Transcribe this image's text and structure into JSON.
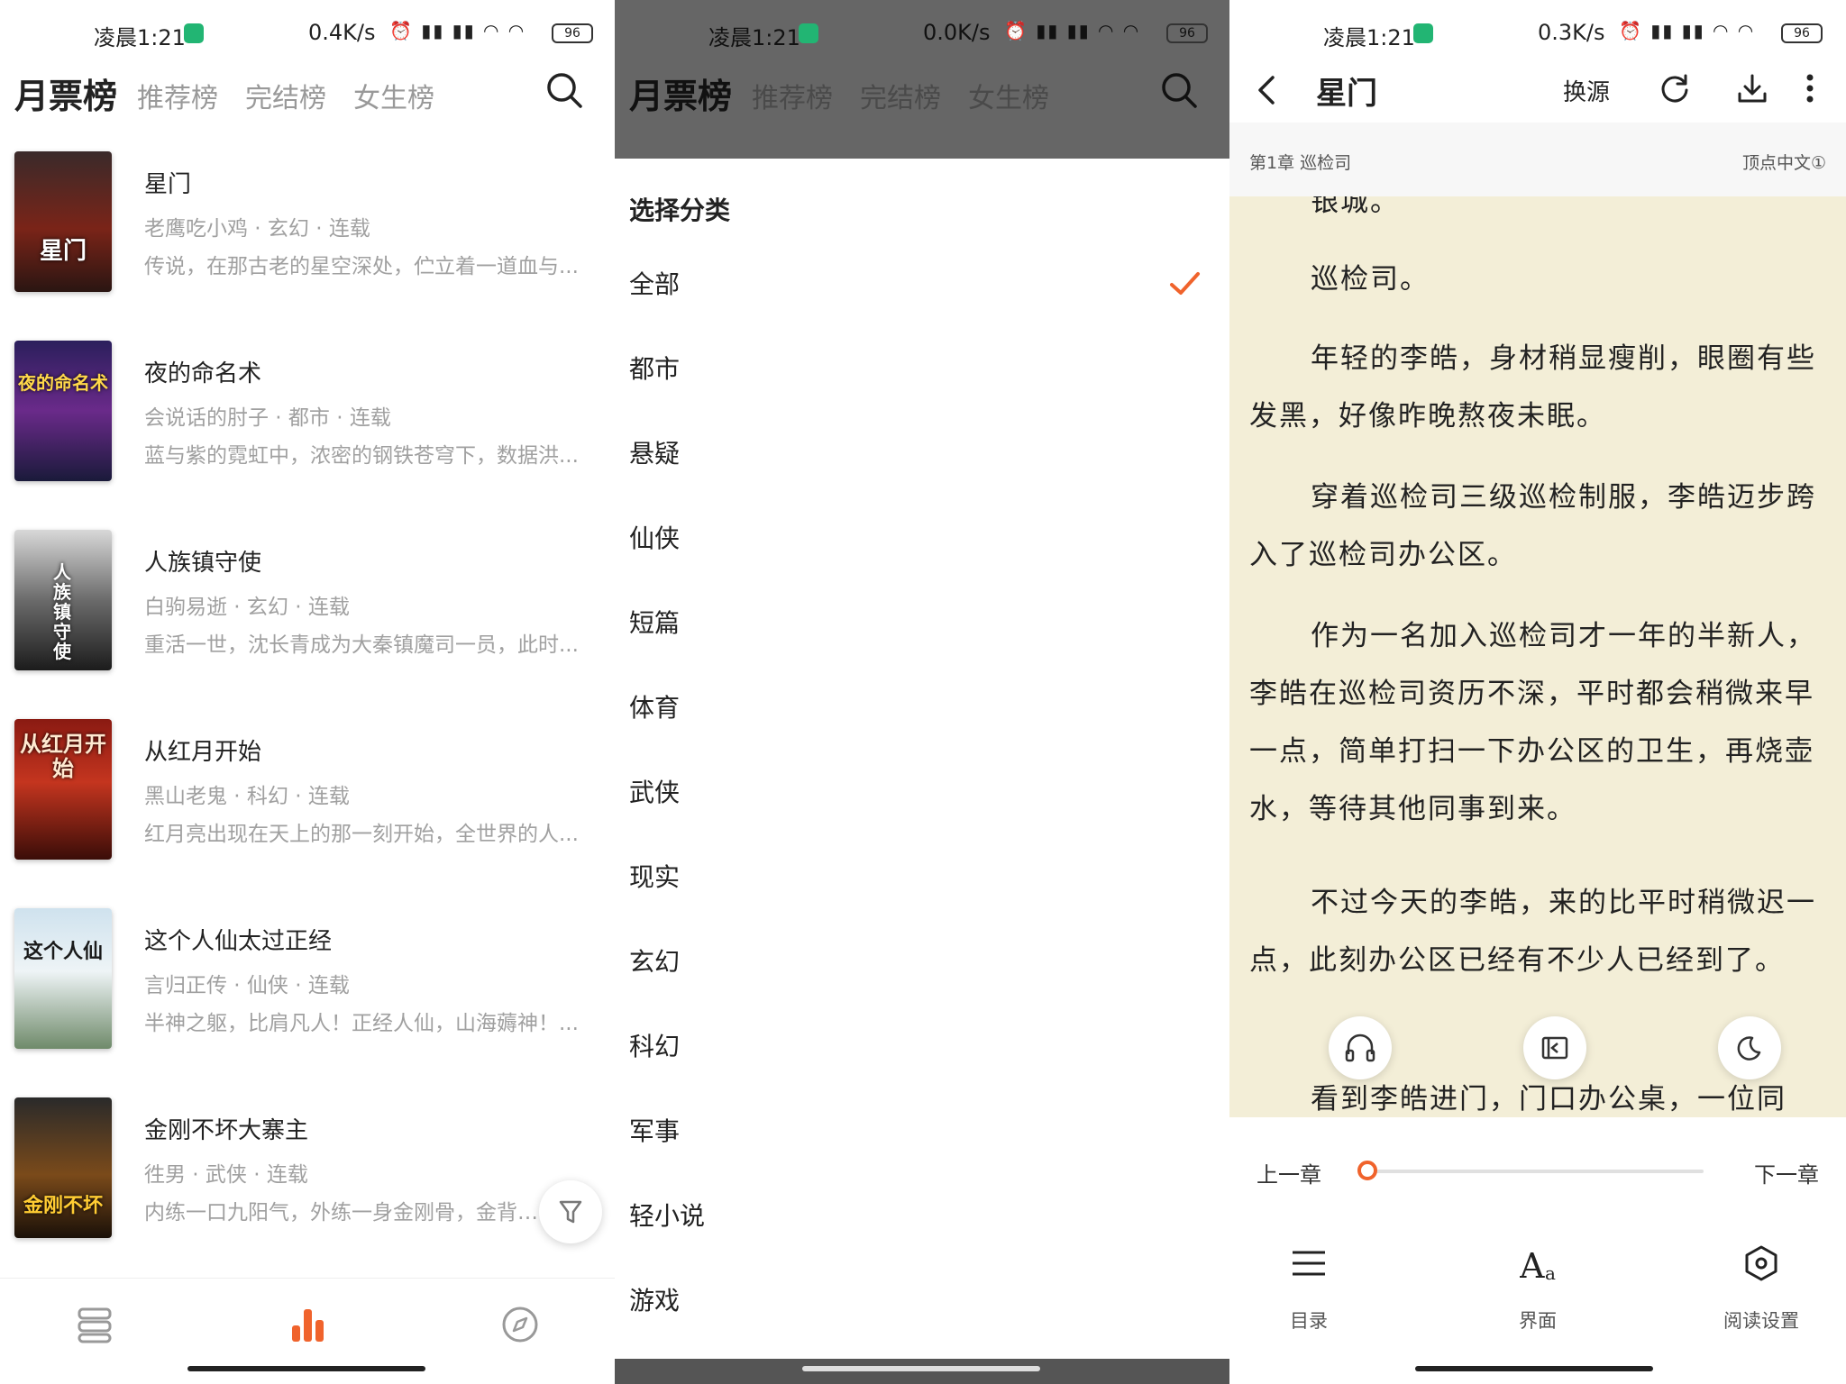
{
  "status_bars": [
    {
      "time": "凌晨1:21",
      "net": "0.4K/s",
      "battery": "96"
    },
    {
      "time": "凌晨1:21",
      "net": "0.0K/s",
      "battery": "96"
    },
    {
      "time": "凌晨1:21",
      "net": "0.3K/s",
      "battery": "96"
    }
  ],
  "ranking": {
    "tabs": [
      "月票榜",
      "推荐榜",
      "完结榜",
      "女生榜"
    ],
    "books": [
      {
        "title": "星门",
        "cover_text": "星门",
        "meta": "老鹰吃小鸡 · 玄幻 · 连载",
        "desc": "传说，在那古老的星空深处，伫立着一道血与..."
      },
      {
        "title": "夜的命名术",
        "cover_text": "夜的命名术",
        "meta": "会说话的肘子 · 都市 · 连载",
        "desc": "蓝与紫的霓虹中，浓密的钢铁苍穹下，数据洪..."
      },
      {
        "title": "人族镇守使",
        "cover_text": "人族镇守使",
        "meta": "白驹易逝 · 玄幻 · 连载",
        "desc": "重活一世，沈长青成为大秦镇魔司一员，此时..."
      },
      {
        "title": "从红月开始",
        "cover_text": "从红月开始",
        "meta": "黑山老鬼 · 科幻 · 连载",
        "desc": "红月亮出现在天上的那一刻开始，全世界的人..."
      },
      {
        "title": "这个人仙太过正经",
        "cover_text": "这个人仙",
        "meta": "言归正传 · 仙侠 · 连载",
        "desc": "半神之躯，比肩凡人！正经人仙，山海薅神！..."
      },
      {
        "title": "金刚不坏大寨主",
        "cover_text": "金刚不坏",
        "meta": "徃男 · 武侠 · 连载",
        "desc": "内练一口九阳气，外练一身金刚骨，金背大..."
      }
    ]
  },
  "category_sheet": {
    "title": "选择分类",
    "items": [
      "全部",
      "都市",
      "悬疑",
      "仙侠",
      "短篇",
      "体育",
      "武侠",
      "现实",
      "玄幻",
      "科幻",
      "军事",
      "轻小说",
      "游戏"
    ],
    "selected": "全部",
    "accent": "#f0632c"
  },
  "reader": {
    "book_title": "星门",
    "change_source": "换源",
    "chapter": "第1章 巡检司",
    "source": "顶点中文①",
    "paragraphs": [
      "银城。",
      "巡检司。",
      "年轻的李皓，身材稍显瘦削，眼圈有些发黑，好像昨晚熬夜未眠。",
      "穿着巡检司三级巡检制服，李皓迈步跨入了巡检司办公区。",
      "作为一名加入巡检司才一年的半新人，李皓在巡检司资历不深，平时都会稍微来早一点，简单打扫一下办公区的卫生，再烧壶水，等待其他同事到来。",
      "不过今天的李皓，来的比平时稍微迟一点，此刻办公区已经有不少人已经到了。",
      "看到李皓进门，门口办公桌，一位同"
    ],
    "prev_chapter": "上一章",
    "next_chapter": "下一章",
    "progress": 0.0,
    "tools": [
      "目录",
      "界面",
      "阅读设置"
    ],
    "page_color": "#f3eed7"
  }
}
